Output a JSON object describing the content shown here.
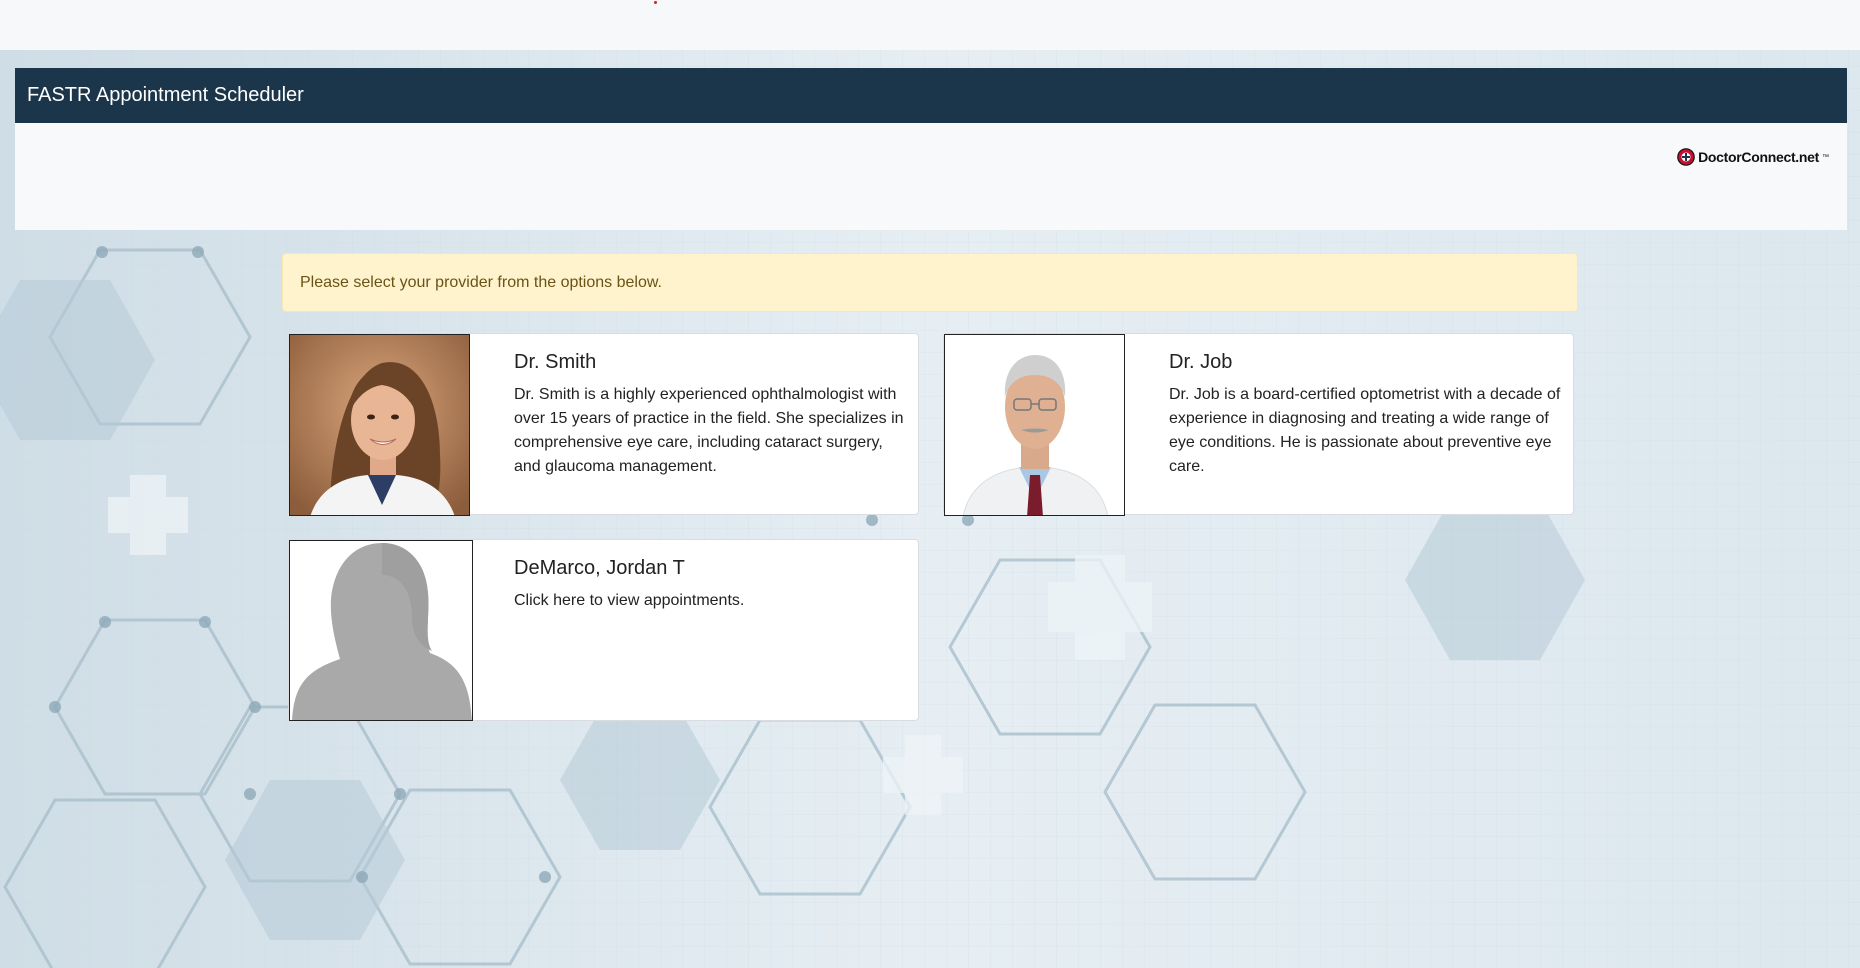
{
  "app": {
    "title": "FASTR Appointment Scheduler"
  },
  "logo": {
    "text": "DoctorConnect.net",
    "trademark": "™",
    "icon": "doctorconnect-logo-icon"
  },
  "alert": {
    "message": "Please select your provider from the options below."
  },
  "providers": [
    {
      "name": "Dr. Smith",
      "description": "Dr. Smith is a highly experienced ophthalmologist with over 15 years of practice in the field. She specializes in comprehensive eye care, including cataract surgery, and glaucoma management.",
      "photo": "woman-portrait"
    },
    {
      "name": "Dr. Job",
      "description": "Dr. Job is a board-certified optometrist with a decade of experience in diagnosing and treating a wide range of eye conditions. He is passionate about preventive eye care.",
      "photo": "man-portrait"
    },
    {
      "name": "DeMarco, Jordan T",
      "description": "Click here to view appointments.",
      "photo": "placeholder-silhouette"
    }
  ],
  "colors": {
    "header": "#1b364b",
    "alert_bg": "#fff3cd",
    "alert_text": "#6a5316",
    "page_bg": "#dfe8ee"
  }
}
